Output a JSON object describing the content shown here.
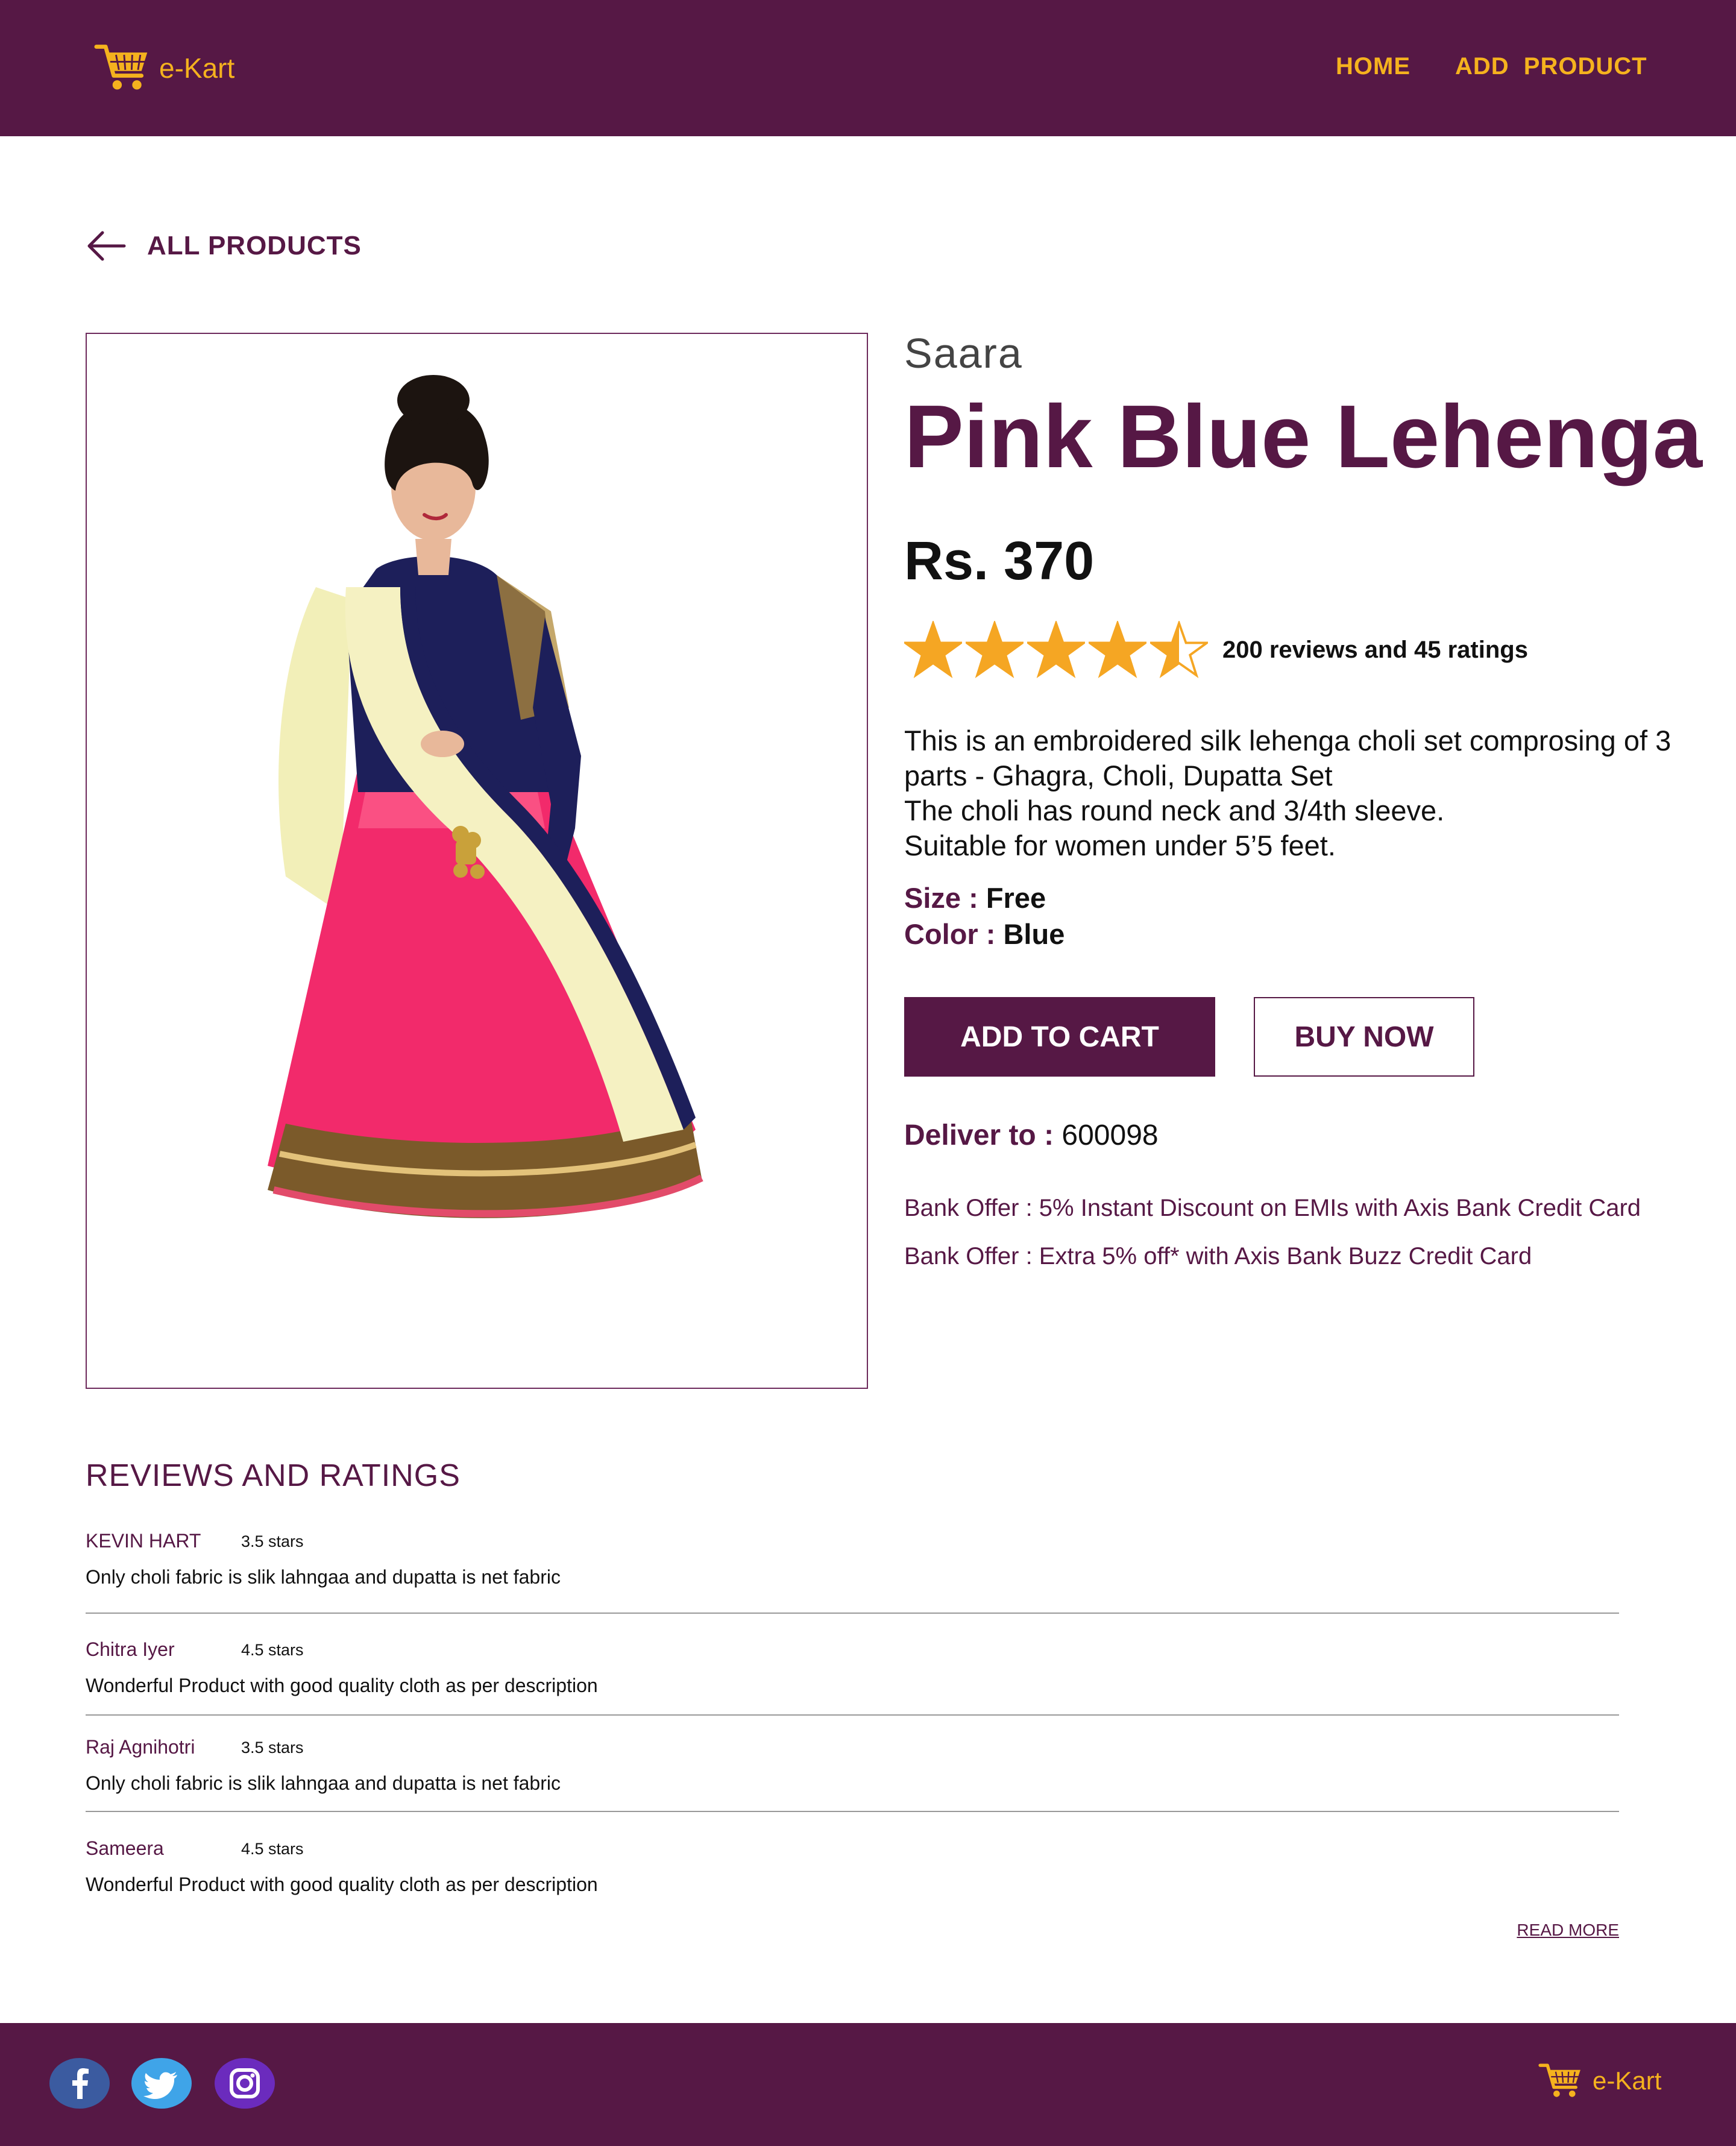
{
  "header": {
    "logo_text": "e-Kart",
    "nav": {
      "home": "HOME",
      "add_product": "ADD  PRODUCT"
    }
  },
  "back_link": {
    "label": "ALL PRODUCTS"
  },
  "product": {
    "brand": "Saara",
    "title": "Pink Blue Lehenga",
    "price": "Rs. 370",
    "rating_value": 4.5,
    "rating_max": 5,
    "rating_text": "200 reviews and 45 ratings",
    "description": [
      "This is an embroidered silk lehenga choli set comprosing of 3",
      "parts - Ghagra, Choli, Dupatta Set",
      "The choli has round neck and 3/4th sleeve.",
      "Suitable for women under 5’5 feet."
    ],
    "size_key": "Size : ",
    "size_value": "Free",
    "color_key": "Color : ",
    "color_value": "Blue",
    "add_to_cart": "ADD TO CART",
    "buy_now": "BUY NOW",
    "deliver_key": "Deliver to : ",
    "deliver_value": "600098",
    "offers": [
      "Bank Offer : 5% Instant Discount on EMIs with Axis Bank Credit Card",
      "Bank Offer : Extra 5% off* with Axis Bank Buzz Credit Card"
    ]
  },
  "reviews": {
    "title": "REVIEWS AND RATINGS",
    "items": [
      {
        "name": "KEVIN HART",
        "stars": "3.5 stars",
        "text": "Only choli fabric is slik lahngaa and dupatta is net fabric"
      },
      {
        "name": "Chitra Iyer",
        "stars": "4.5 stars",
        "text": "Wonderful Product with good quality cloth as per description"
      },
      {
        "name": "Raj Agnihotri",
        "stars": "3.5 stars",
        "text": "Only choli fabric is slik lahngaa and dupatta is net fabric"
      },
      {
        "name": "Sameera",
        "stars": "4.5 stars",
        "text": "Wonderful Product with good quality cloth as per description"
      }
    ],
    "read_more": "READ MORE"
  },
  "footer": {
    "logo_text": "e-Kart",
    "social": [
      "facebook-icon",
      "twitter-icon",
      "instagram-icon"
    ]
  },
  "colors": {
    "brand_purple": "#561845",
    "accent_yellow": "#f5b21e",
    "star": "#f5a623"
  }
}
